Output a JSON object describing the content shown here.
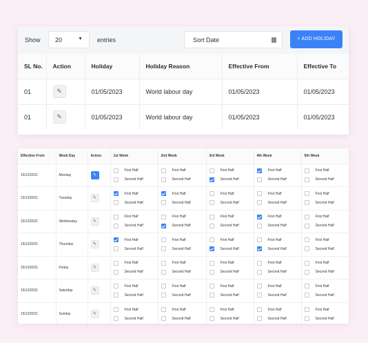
{
  "controls": {
    "show_label": "Show",
    "page_size": "20",
    "entries_label": "entries",
    "sort_placeholder": "Sort Date",
    "add_button": "+ ADD HOLIDAY"
  },
  "holidays": {
    "columns": [
      "SL No.",
      "Action",
      "Holiday",
      "Holiday Reason",
      "Effective From",
      "Effective To"
    ],
    "rows": [
      {
        "sl": "01",
        "holiday": "01/05/2023",
        "reason": "World labour day",
        "from": "01/05/2023",
        "to": "01/05/2023"
      },
      {
        "sl": "01",
        "holiday": "01/05/2023",
        "reason": "World labour day",
        "from": "01/05/2023",
        "to": "01/05/2023"
      }
    ]
  },
  "weekoff": {
    "columns": [
      "Effective From",
      "Week Day",
      "Action",
      "1st Week",
      "2nd Week",
      "3rd Week",
      "4th Week",
      "5th Week"
    ],
    "first_half_label": "First Half",
    "second_half_label": "Second Half",
    "rows": [
      {
        "date": "15/12/2021",
        "day": "Monday",
        "action_active": true,
        "checks": [
          [
            false,
            false
          ],
          [
            false,
            false
          ],
          [
            false,
            true
          ],
          [
            true,
            false
          ],
          [
            false,
            false
          ]
        ]
      },
      {
        "date": "15/12/2021",
        "day": "Tuesday",
        "action_active": false,
        "checks": [
          [
            true,
            false
          ],
          [
            true,
            false
          ],
          [
            false,
            false
          ],
          [
            false,
            false
          ],
          [
            false,
            false
          ]
        ]
      },
      {
        "date": "15/12/2021",
        "day": "Wednesday",
        "action_active": false,
        "checks": [
          [
            false,
            false
          ],
          [
            false,
            true
          ],
          [
            false,
            false
          ],
          [
            true,
            false
          ],
          [
            false,
            false
          ]
        ]
      },
      {
        "date": "15/12/2021",
        "day": "Thursday",
        "action_active": false,
        "checks": [
          [
            true,
            false
          ],
          [
            false,
            false
          ],
          [
            false,
            true
          ],
          [
            false,
            true
          ],
          [
            false,
            false
          ]
        ]
      },
      {
        "date": "15/12/2021",
        "day": "Friday",
        "action_active": false,
        "checks": [
          [
            false,
            false
          ],
          [
            false,
            false
          ],
          [
            false,
            false
          ],
          [
            false,
            false
          ],
          [
            false,
            false
          ]
        ]
      },
      {
        "date": "15/12/2021",
        "day": "Saturday",
        "action_active": false,
        "checks": [
          [
            false,
            false
          ],
          [
            false,
            false
          ],
          [
            false,
            false
          ],
          [
            false,
            false
          ],
          [
            false,
            false
          ]
        ]
      },
      {
        "date": "15/12/2021",
        "day": "Sunday",
        "action_active": false,
        "checks": [
          [
            false,
            false
          ],
          [
            false,
            false
          ],
          [
            false,
            false
          ],
          [
            false,
            false
          ],
          [
            false,
            false
          ]
        ]
      }
    ]
  },
  "icons": {
    "edit": "pencil-icon",
    "calendar": "calendar-icon",
    "dropdown": "chevron-down-icon"
  },
  "colors": {
    "accent": "#3b82f6",
    "background": "#fbeff6"
  }
}
